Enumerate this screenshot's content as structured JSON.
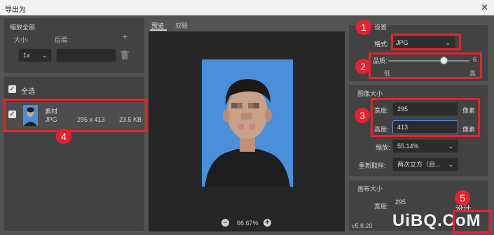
{
  "window": {
    "title": "导出为",
    "close": "✕"
  },
  "scale_all": {
    "header": "缩放全部",
    "size_label": "大小:",
    "suffix_label": "后缀:",
    "size_value": "1x",
    "add": "+"
  },
  "select_all": {
    "label": "全选"
  },
  "asset": {
    "name": "素材",
    "format": "JPG",
    "dims": "295 x 413",
    "filesize": "23.5 KB"
  },
  "tabs": {
    "preview": "预览",
    "artboard": "双联"
  },
  "zoom": {
    "minus": "−",
    "value": "66.67%",
    "plus": "+"
  },
  "settings": {
    "section": "设置",
    "format_label": "格式:",
    "format_value": "JPG",
    "quality_label": "品质:",
    "quality_value": "6",
    "quality_fraction": 0.58,
    "low": "低",
    "high": "高"
  },
  "image_size": {
    "section": "图像大小",
    "width_label": "宽度:",
    "width_value": "295",
    "width_unit": "像素",
    "height_label": "高度:",
    "height_value": "413",
    "height_unit": "像素",
    "scale_label": "缩放:",
    "scale_value": "55.14%",
    "resample_label": "重新取样:",
    "resample_value": "两次立方（自..."
  },
  "canvas_size": {
    "section": "画布大小",
    "width_label": "宽度:",
    "width_value": "295"
  },
  "version": "v5.8.20",
  "annotations": [
    "1",
    "2",
    "3",
    "4",
    "5"
  ],
  "watermark": {
    "text": "UiBQ.CoM",
    "sub": "设计"
  },
  "colors": {
    "accent": "#e8212f",
    "photo_bg": "#4a90d9",
    "panel": "#424242"
  }
}
